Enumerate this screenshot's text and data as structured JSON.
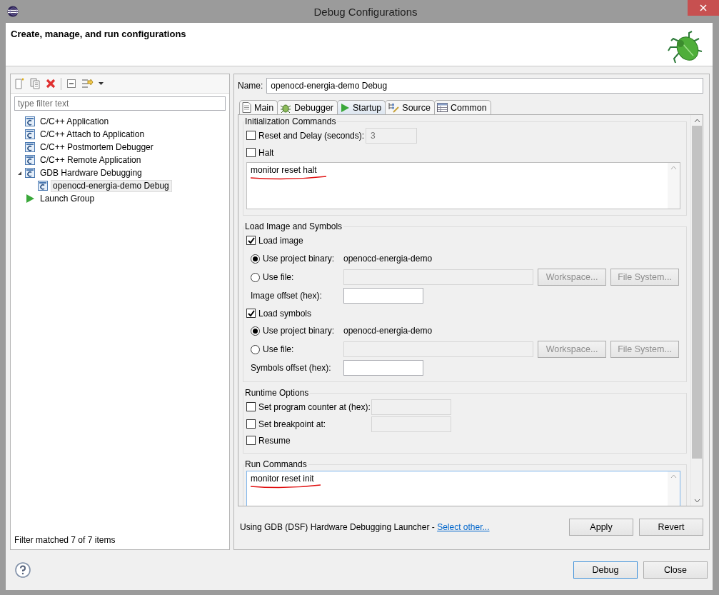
{
  "window": {
    "title": "Debug Configurations"
  },
  "header": {
    "title": "Create, manage, and run configurations"
  },
  "sidebar": {
    "filter": {
      "placeholder": "type filter text"
    },
    "tree": [
      {
        "label": "C/C++ Application",
        "kind": "config",
        "selected": false
      },
      {
        "label": "C/C++ Attach to Application",
        "kind": "config",
        "selected": false
      },
      {
        "label": "C/C++ Postmortem Debugger",
        "kind": "config",
        "selected": false
      },
      {
        "label": "C/C++ Remote Application",
        "kind": "config",
        "selected": false
      },
      {
        "label": "GDB Hardware Debugging",
        "kind": "config",
        "selected": false,
        "expanded": true,
        "children": [
          {
            "label": "openocd-energia-demo Debug",
            "kind": "config",
            "selected": true
          }
        ]
      },
      {
        "label": "Launch Group",
        "kind": "group",
        "selected": false
      }
    ],
    "status": "Filter matched 7 of 7 items"
  },
  "config": {
    "name_label": "Name:",
    "name": "openocd-energia-demo Debug",
    "tabs": [
      {
        "label": "Main",
        "selected": false
      },
      {
        "label": "Debugger",
        "selected": false
      },
      {
        "label": "Startup",
        "selected": true
      },
      {
        "label": "Source",
        "selected": false
      },
      {
        "label": "Common",
        "selected": false
      }
    ],
    "sections": [
      {
        "title": "Initialization Commands",
        "rows": [
          {
            "kind": "checkbox",
            "label": "Reset and Delay (seconds):",
            "checked": false,
            "value": "3",
            "disabled": true
          },
          {
            "kind": "checkbox",
            "label": "Halt",
            "checked": false
          },
          {
            "kind": "textarea",
            "value": "monitor reset halt"
          }
        ]
      },
      {
        "title": "Load Image and Symbols",
        "rows": [
          {
            "kind": "checkbox",
            "label": "Load image",
            "checked": true
          },
          {
            "kind": "radio",
            "label": "Use project binary:",
            "selected": true,
            "value": "openocd-energia-demo"
          },
          {
            "kind": "radio",
            "label": "Use file:",
            "selected": false,
            "buttons": [
              {
                "label": "Workspace...",
                "disabled": true
              },
              {
                "label": "File System...",
                "disabled": true
              }
            ]
          },
          {
            "kind": "field",
            "label": "Image offset (hex):"
          },
          {
            "kind": "checkbox",
            "label": "Load symbols",
            "checked": true
          },
          {
            "kind": "radio",
            "label": "Use project binary:",
            "selected": true,
            "value": "openocd-energia-demo"
          },
          {
            "kind": "radio",
            "label": "Use file:",
            "selected": false,
            "buttons": [
              {
                "label": "Workspace...",
                "disabled": true
              },
              {
                "label": "File System...",
                "disabled": true
              }
            ]
          },
          {
            "kind": "field",
            "label": "Symbols offset (hex):"
          }
        ]
      },
      {
        "title": "Runtime Options",
        "rows": [
          {
            "kind": "checkbox",
            "label": "Set program counter at (hex):",
            "checked": false,
            "disabled": true
          },
          {
            "kind": "checkbox",
            "label": "Set breakpoint at:",
            "checked": false,
            "disabled": true
          },
          {
            "kind": "checkbox",
            "label": "Resume",
            "checked": false
          }
        ]
      },
      {
        "title": "Run Commands",
        "rows": [
          {
            "kind": "textarea",
            "value": "monitor reset init"
          }
        ]
      }
    ],
    "launcher": {
      "text": "Using GDB (DSF) Hardware Debugging Launcher - ",
      "link": "Select other..."
    },
    "buttons": [
      {
        "label": "Apply"
      },
      {
        "label": "Revert"
      }
    ]
  },
  "footer": {
    "buttons": [
      {
        "label": "Debug",
        "default": true
      },
      {
        "label": "Close",
        "default": false
      }
    ]
  }
}
